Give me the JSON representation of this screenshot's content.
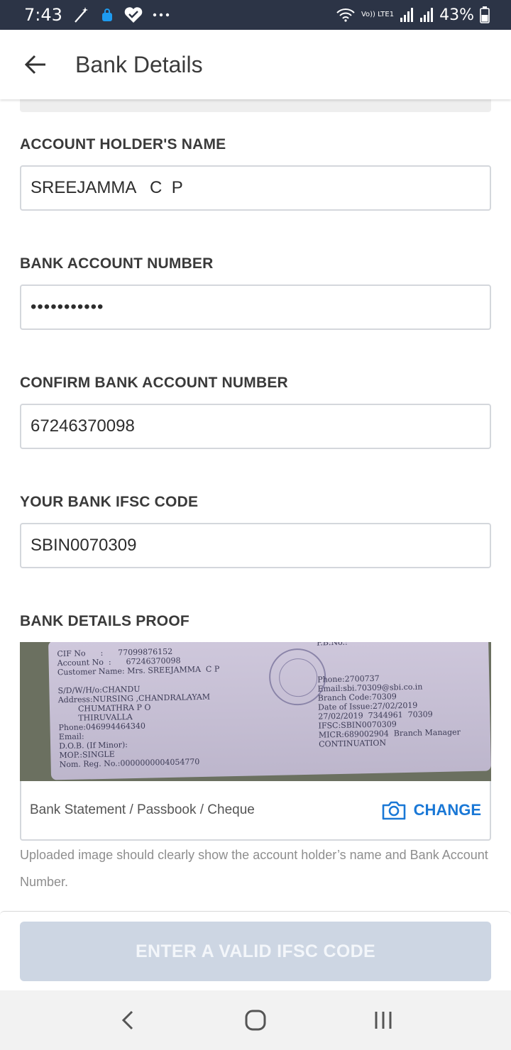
{
  "status_bar": {
    "time": "7:43",
    "battery": "43%",
    "network_label": "Vo)) LTE1",
    "icons": [
      "magic-wand-icon",
      "shopping-bag-icon",
      "heart-icon",
      "more-dots-icon",
      "wifi-icon",
      "signal-icon",
      "signal-icon",
      "battery-icon"
    ]
  },
  "app_bar": {
    "title": "Bank Details",
    "back_icon": "arrow-left-icon"
  },
  "form": {
    "account_holder": {
      "label": "ACCOUNT HOLDER'S NAME",
      "value": "SREEJAMMA   C  P"
    },
    "account_number": {
      "label": "BANK ACCOUNT NUMBER",
      "value": "•••••••••••"
    },
    "confirm_account_number": {
      "label": "CONFIRM BANK ACCOUNT NUMBER",
      "value": "67246370098"
    },
    "ifsc": {
      "label": "YOUR BANK IFSC CODE",
      "value": "SBIN0070309"
    }
  },
  "proof": {
    "label": "BANK DETAILS PROOF",
    "doc_type": "Bank Statement / Passbook / Cheque",
    "change_label": "CHANGE",
    "change_icon": "camera-icon",
    "helper": "Uploaded image should clearly show the account holder’s name and Bank Account Number.",
    "image_left_text": "CIF No      :      77099876152\nAccount No  :      67246370098\nCustomer Name: Mrs. SREEJAMMA  C P\n\nS/D/W/H/o:CHANDU\nAddress:NURSING ,CHANDRALAYAM\n        CHUMATHRA P O\n        THIRUVALLA\nPhone:046994464340\nEmail:\nD.O.B. (If Minor):\nMOP.:SINGLE\nNom. Reg. No.:0000000004054770",
    "image_right_text": "P.B.No.:\n\n\n\nPhone:2700737\nEmail:sbi.70309@sbi.co.in\nBranch Code:70309\nDate of Issue:27/02/2019\n27/02/2019  7344961  70309\nIFSC:SBIN0070309\nMICR:689002904  Branch Manager\nCONTINUATION"
  },
  "submit": {
    "label": "ENTER A VALID IFSC CODE"
  },
  "nav_bar": {
    "icons": [
      "nav-back-icon",
      "nav-home-icon",
      "nav-recents-icon"
    ]
  },
  "colors": {
    "accent": "#1a78d6",
    "status_bar": "#2c3446",
    "disabled_button": "#cdd6e3"
  }
}
